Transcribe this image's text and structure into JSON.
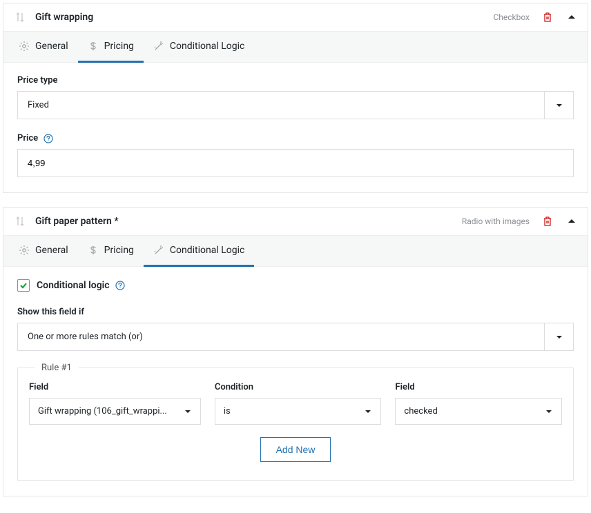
{
  "panel1": {
    "title": "Gift wrapping",
    "type": "Checkbox",
    "tabs": {
      "general": "General",
      "pricing": "Pricing",
      "conditional": "Conditional Logic"
    },
    "priceTypeLabel": "Price type",
    "priceTypeValue": "Fixed",
    "priceLabel": "Price",
    "priceValue": "4,99"
  },
  "panel2": {
    "title": "Gift paper pattern *",
    "type": "Radio with images",
    "tabs": {
      "general": "General",
      "pricing": "Pricing",
      "conditional": "Conditional Logic"
    },
    "condLogicLabel": "Conditional logic",
    "showIfLabel": "Show this field if",
    "showIfValue": "One or more rules match (or)",
    "ruleLegend": "Rule #1",
    "ruleFieldLabel": "Field",
    "ruleFieldValue": "Gift wrapping (106_gift_wrappi...",
    "ruleCondLabel": "Condition",
    "ruleCondValue": "is",
    "ruleVal2Label": "Field",
    "ruleVal2Value": "checked",
    "addNewLabel": "Add New"
  }
}
